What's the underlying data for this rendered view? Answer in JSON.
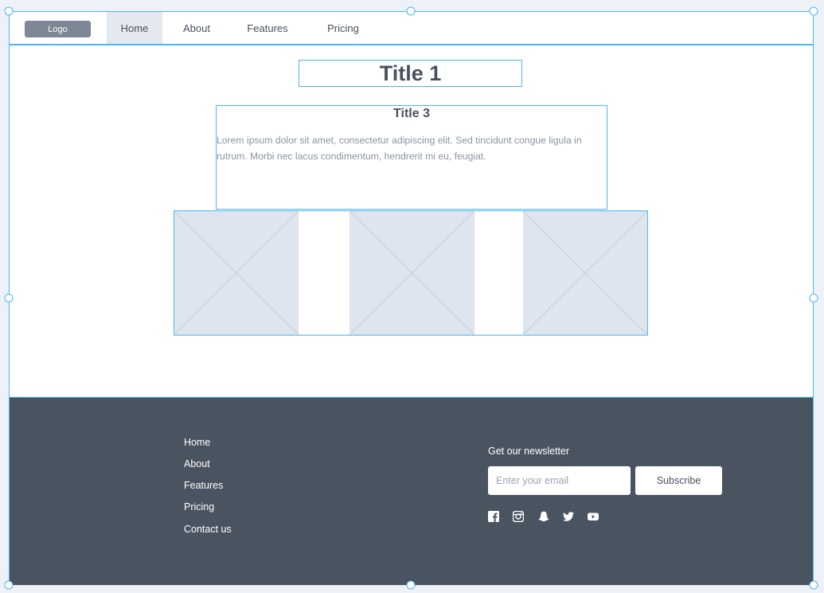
{
  "nav": {
    "logo": "Logo",
    "items": [
      {
        "label": "Home",
        "active": true
      },
      {
        "label": "About",
        "active": false
      },
      {
        "label": "Features",
        "active": false
      },
      {
        "label": "Pricing",
        "active": false
      }
    ]
  },
  "content": {
    "title1": "Title 1",
    "title3": "Title 3",
    "body": "Lorem ipsum dolor sit amet, consectetur adipiscing elit. Sed tincidunt congue ligula in rutrum. Morbi nec lacus condimentum, hendrerit mi eu, feugiat."
  },
  "footer": {
    "links": [
      "Home",
      "About",
      "Features",
      "Pricing",
      "Contact us"
    ],
    "newsletter_title": "Get our newsletter",
    "email_placeholder": "Enter your email",
    "subscribe_label": "Subscribe",
    "social_icons": [
      "facebook-icon",
      "instagram-icon",
      "snapchat-icon",
      "twitter-icon",
      "youtube-icon"
    ]
  },
  "colors": {
    "selection": "#4ab8f0",
    "footer_bg": "#4a5360",
    "placeholder_fill": "#dfe5ee",
    "logo_bg": "#7e8796"
  }
}
